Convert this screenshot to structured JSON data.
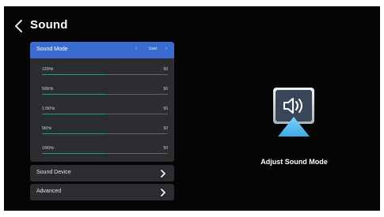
{
  "header": {
    "title": "Sound"
  },
  "sound_mode": {
    "label": "Sound Mode",
    "value": "User"
  },
  "equalizer": [
    {
      "label": "120Hz",
      "value": "50",
      "level": 0.5
    },
    {
      "label": "500Hz",
      "value": "50",
      "level": 0.5
    },
    {
      "label": "1.5KHz",
      "value": "50",
      "level": 0.5
    },
    {
      "label": "5KHz",
      "value": "50",
      "level": 0.5
    },
    {
      "label": "10KHz",
      "value": "50",
      "level": 0.5
    }
  ],
  "menu": {
    "sound_device": "Sound Device",
    "advanced": "Advanced"
  },
  "preview": {
    "caption": "Adjust Sound Mode",
    "icon": "speaker-icon"
  },
  "colors": {
    "background": "#050505",
    "panel": "#2b2d31",
    "highlight": "#3a6cd0",
    "slider_fill": "#1aa082",
    "icon_blue": "#5ec6f2"
  }
}
